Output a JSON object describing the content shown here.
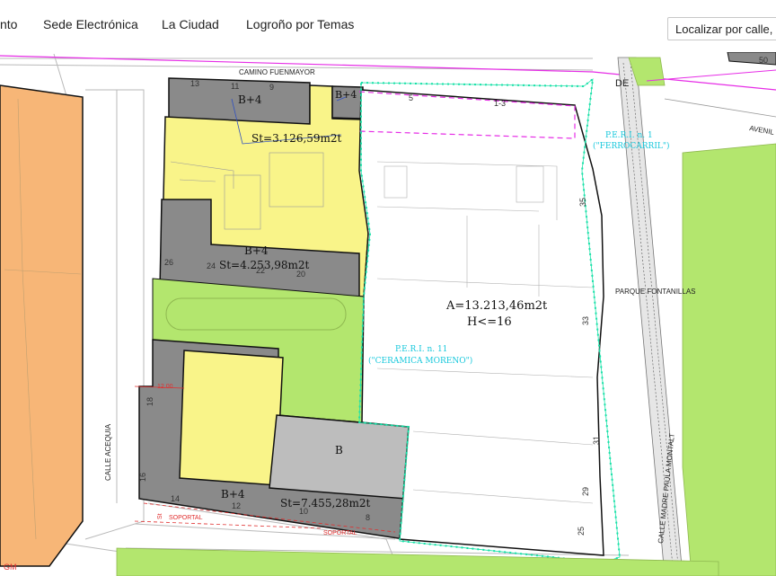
{
  "nav": {
    "item_partial": "nto",
    "sede": "Sede Electrónica",
    "ciudad": "La Ciudad",
    "temas": "Logroño por Temas"
  },
  "search": {
    "placeholder": "Localizar por calle, lugar..."
  },
  "colors": {
    "orange": "#f7b677",
    "yellow": "#f9f489",
    "dark_gray": "#8a8a8a",
    "light_gray": "#bdbdbd",
    "green": "#b3e66e",
    "cyan_boundary": "#19e1a8",
    "magenta": "#e62de6"
  },
  "map": {
    "streets": {
      "camino_fuenmayor": "CAMINO FUENMAYOR",
      "calle_acequia": "CALLE ACEQUIA",
      "calle_madre": "CALLE MADRE PAULA MONTALT",
      "parque_fontanillas": "PARQUE FONTANILLAS",
      "avenida_partial": "AVENIL",
      "de_partial": "DE"
    },
    "labels": {
      "b4_top": "B+4",
      "b4_corner": "B+4",
      "st_top": "St=3.126,59m2t",
      "b4_mid": "B+4",
      "st_mid": "St=4.253,98m2t",
      "area": "A=13.213,46m2t",
      "height": "H<=16",
      "b": "B",
      "b4_bottom": "B+4",
      "st_bottom": "St=7.455,28m2t",
      "peri11_a": "P.E.R.I. n. 11",
      "peri11_b": "(\"CERAMICA MORENO\")",
      "peri_rail_a": "P.E.R.I. n. 1",
      "peri_rail_b": "(\"FERROCARRIL\")",
      "soportal1": "SOPORTAL",
      "soportal2": "SOPORTAL",
      "dim_12": "12.00",
      "gm_partial": "GM",
      "st_partial": "St"
    },
    "numbers": {
      "n13": "13",
      "n11": "11",
      "n9": "9",
      "n5": "5",
      "n1_3": "1-3",
      "n35": "35",
      "n33": "33",
      "n31": "31",
      "n29": "29",
      "n25": "25",
      "n26": "26",
      "n24": "24",
      "n22": "22",
      "n20": "20",
      "n18": "18",
      "n16": "16",
      "n14": "14",
      "n12": "12",
      "n10": "10",
      "n8": "8",
      "n50": "50"
    }
  }
}
